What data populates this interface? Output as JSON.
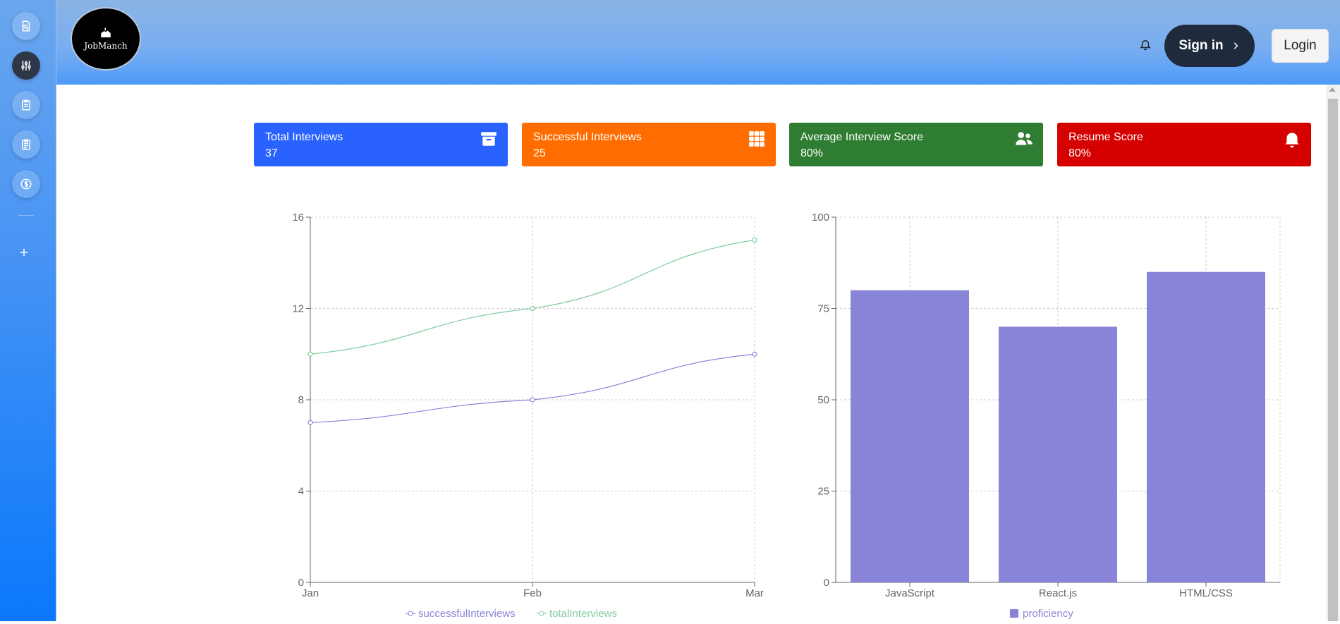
{
  "header": {
    "logo_text": "JobManch",
    "sign_in_label": "Sign in",
    "login_label": "Login"
  },
  "sidebar": {
    "items": [
      {
        "icon": "search-document-icon"
      },
      {
        "icon": "sliders-icon",
        "active": true
      },
      {
        "icon": "clipboard-icon"
      },
      {
        "icon": "clipboard-list-icon"
      },
      {
        "icon": "dollar-icon"
      },
      {
        "icon": "plus-icon"
      }
    ]
  },
  "stats": [
    {
      "title": "Total Interviews",
      "value": "37",
      "color": "#2962ff",
      "icon": "archive-icon"
    },
    {
      "title": "Successful Interviews",
      "value": "25",
      "color": "#ff6d00",
      "icon": "grid-icon"
    },
    {
      "title": "Average Interview Score",
      "value": "80%",
      "color": "#2e7d32",
      "icon": "users-icon"
    },
    {
      "title": "Resume Score",
      "value": "80%",
      "color": "#d50000",
      "icon": "bell-icon"
    }
  ],
  "chart_data": [
    {
      "type": "line",
      "x": [
        "Jan",
        "Feb",
        "Mar"
      ],
      "ylim": [
        0,
        16
      ],
      "yticks": [
        "0",
        "4",
        "8",
        "12",
        "16"
      ],
      "grid": true,
      "legend": "bottom",
      "series": [
        {
          "name": "successfulInterviews",
          "values": [
            7,
            8,
            10
          ],
          "color": "#8884d8"
        },
        {
          "name": "totalInterviews",
          "values": [
            10,
            12,
            15
          ],
          "color": "#82ca9d"
        }
      ]
    },
    {
      "type": "bar",
      "categories": [
        "JavaScript",
        "React.js",
        "HTML/CSS"
      ],
      "ylim": [
        0,
        100
      ],
      "yticks": [
        "0",
        "25",
        "50",
        "75",
        "100"
      ],
      "grid": true,
      "legend": "bottom",
      "series": [
        {
          "name": "proficiency",
          "values": [
            80,
            70,
            85
          ],
          "color": "#8884d8"
        }
      ]
    }
  ]
}
